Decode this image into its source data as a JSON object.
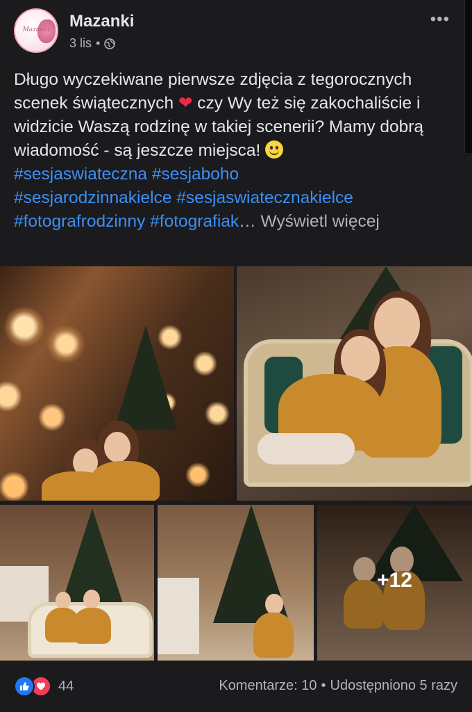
{
  "post": {
    "author": "Mazanki",
    "avatar_text": "Mazanki",
    "time": "3 lis",
    "separator": "•",
    "more_glyph": "•••",
    "text_main": "Długo wyczekiwane pierwsze zdjęcia z tegorocznych scenek świątecznych",
    "heart": "❤",
    "text_cont": " czy Wy też się zakochaliście i widzicie Waszą rodzinę w takiej scenerii? Mamy dobrą wiadomość - są jeszcze miejsca! ",
    "hashtags": [
      "#sesjaswiateczna",
      "#sesjaboho",
      "#sesjarodzinnakielce",
      "#sesjaswiatecznakielce",
      "#fotografrodzinny",
      "#fotografiak"
    ],
    "ellipsis": "…",
    "see_more": "Wyświetl więcej",
    "more_photos": "+12"
  },
  "footer": {
    "reaction_count": "44",
    "comments": "Komentarze: 10",
    "shares": "Udostępniono 5 razy",
    "dot": "•"
  }
}
